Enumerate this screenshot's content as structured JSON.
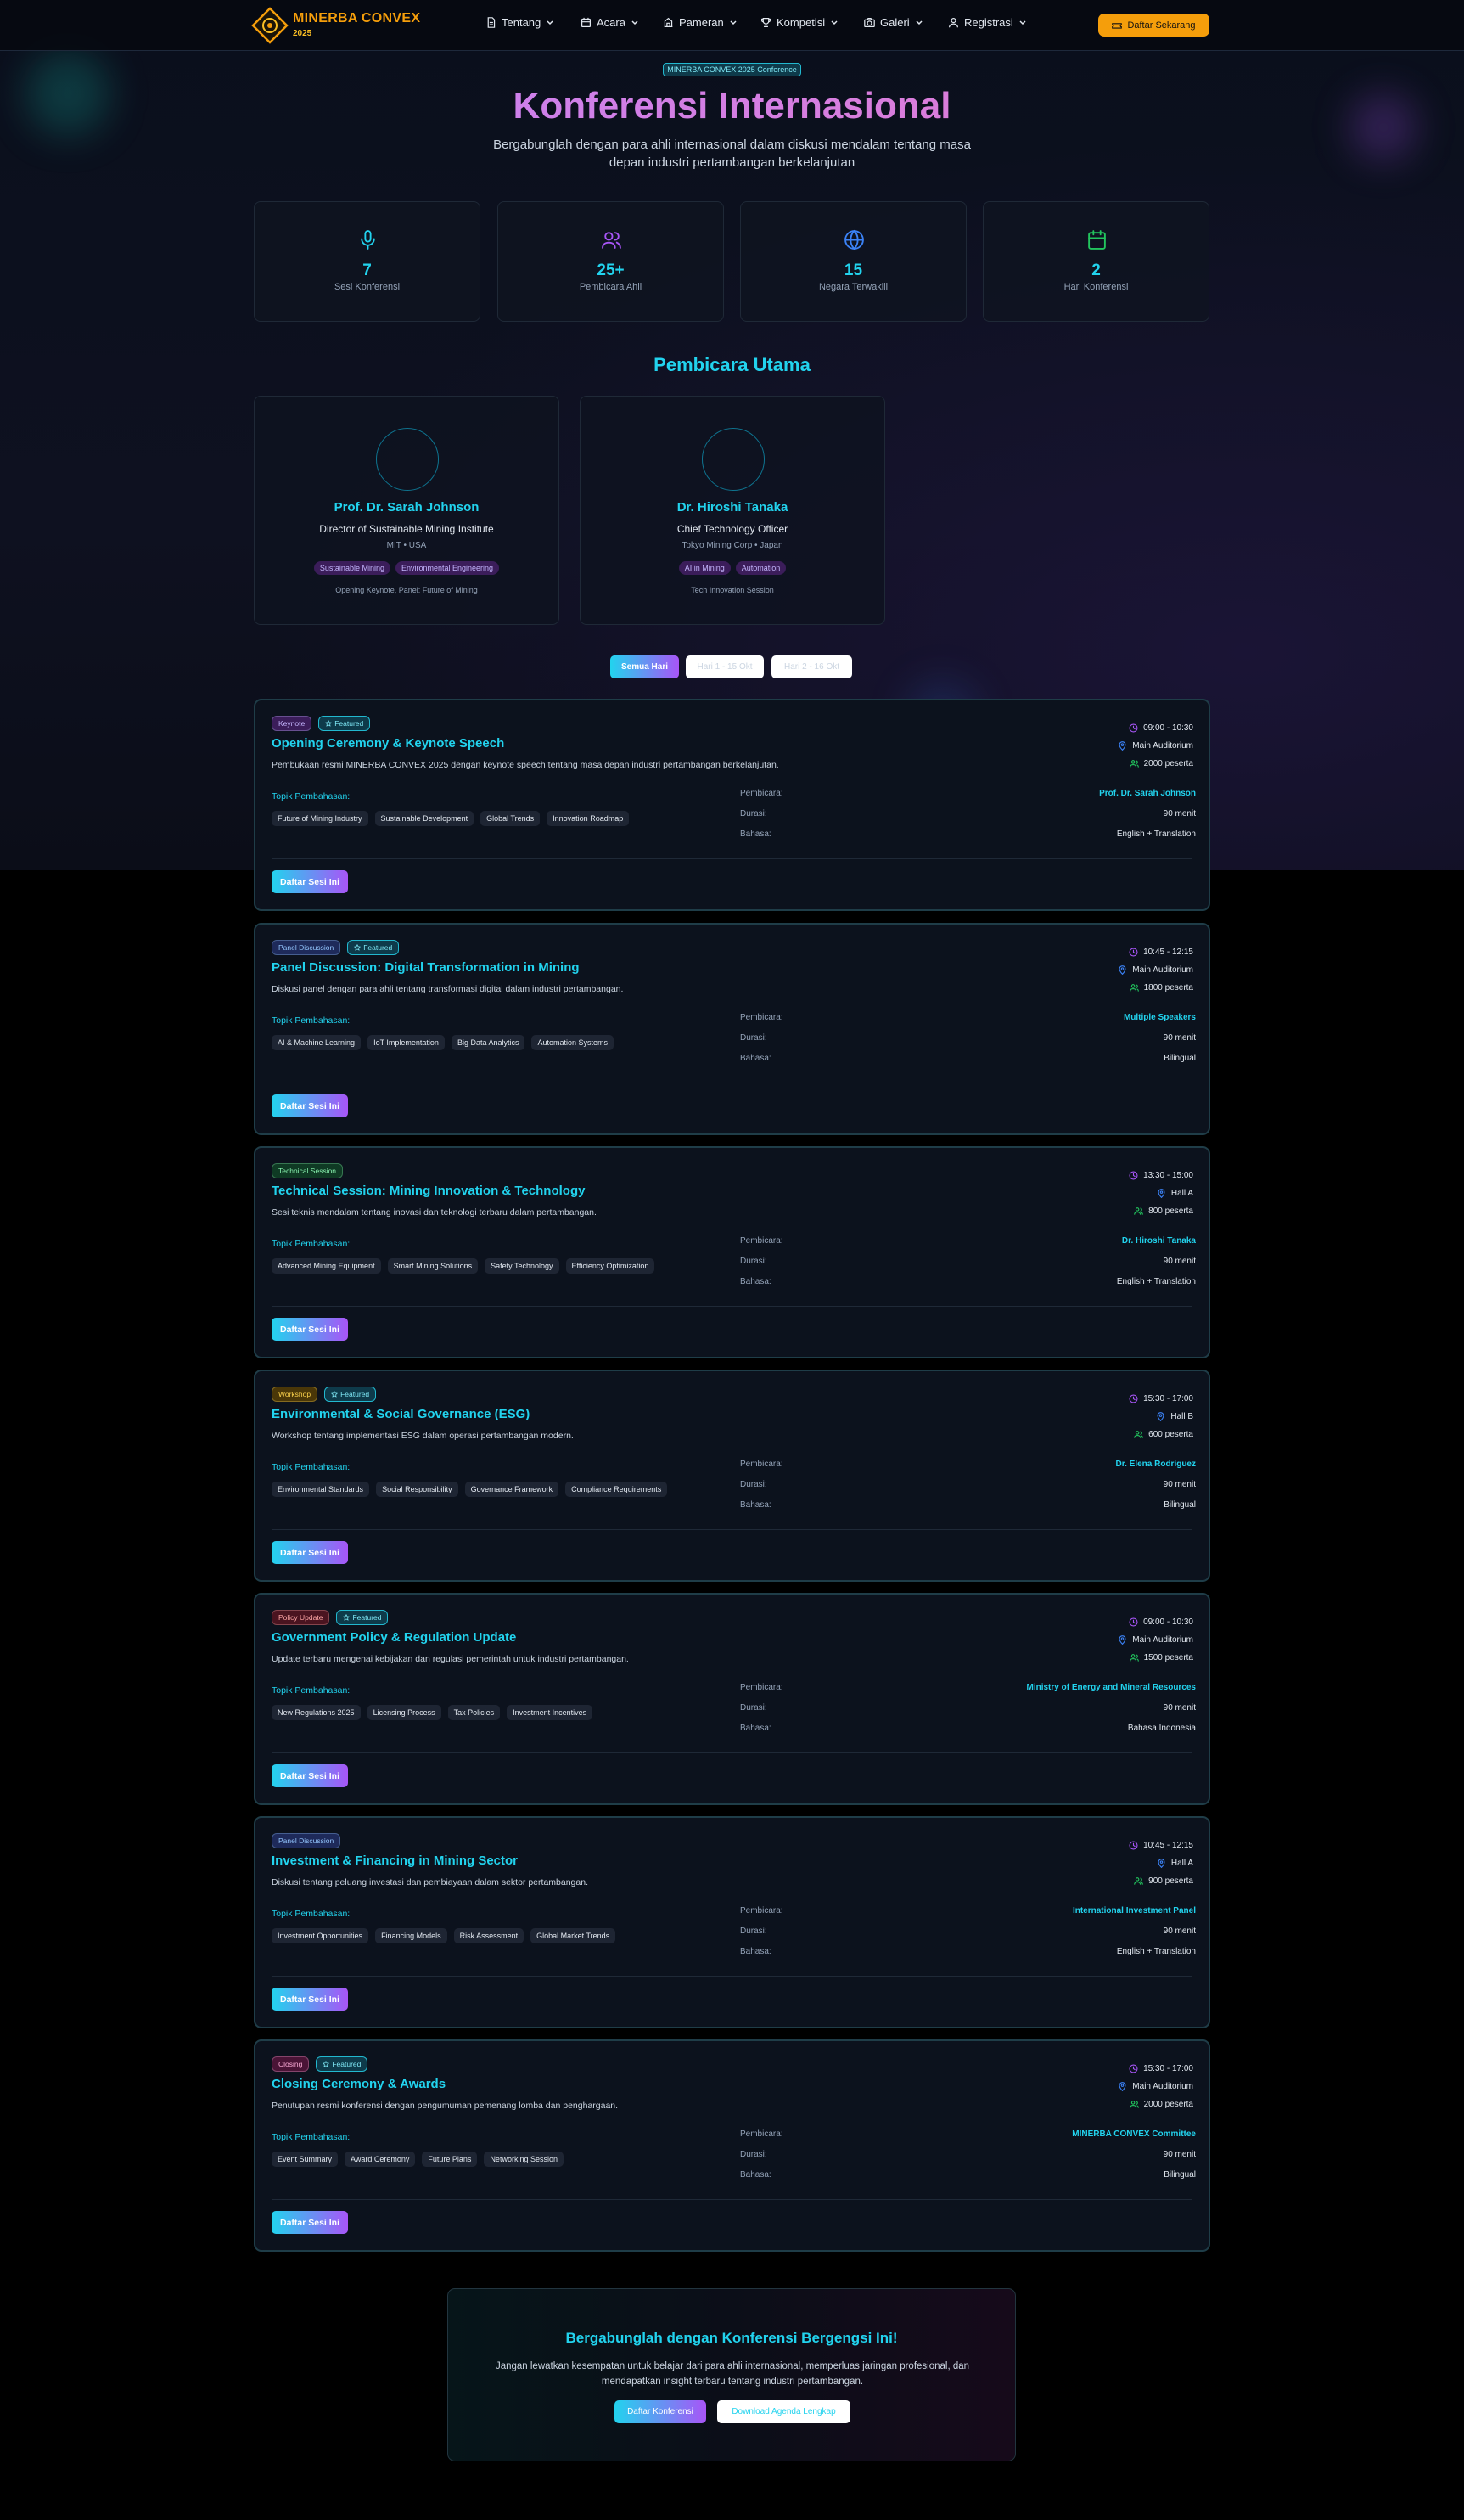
{
  "brand": {
    "name": "MINERBA CONVEX",
    "year": "2025"
  },
  "nav": [
    {
      "label": "Tentang",
      "icon": "document-icon"
    },
    {
      "label": "Acara",
      "icon": "calendar-icon"
    },
    {
      "label": "Pameran",
      "icon": "building-icon"
    },
    {
      "label": "Kompetisi",
      "icon": "trophy-icon"
    },
    {
      "label": "Galeri",
      "icon": "camera-icon"
    },
    {
      "label": "Registrasi",
      "icon": "user-icon"
    }
  ],
  "cta": "Daftar Sekarang",
  "hero": {
    "pill": "MINERBA CONVEX 2025 Conference",
    "title": "Konferensi Internasional",
    "subtitle": "Bergabunglah dengan para ahli internasional dalam diskusi mendalam tentang masa depan industri pertambangan berkelanjutan"
  },
  "stats": [
    {
      "value": "7",
      "label": "Sesi Konferensi",
      "icon": "microphone-icon",
      "color": "#22d3ee"
    },
    {
      "value": "25+",
      "label": "Pembicara Ahli",
      "icon": "users-icon",
      "color": "#a855f7"
    },
    {
      "value": "15",
      "label": "Negara Terwakili",
      "icon": "globe-icon",
      "color": "#3b82f6"
    },
    {
      "value": "2",
      "label": "Hari Konferensi",
      "icon": "calendar-icon",
      "color": "#22c55e"
    }
  ],
  "speakers_title": "Pembicara Utama",
  "speakers": [
    {
      "name": "Prof. Dr. Sarah Johnson",
      "role": "Director of Sustainable Mining Institute",
      "org": "MIT • USA",
      "tags": [
        "Sustainable Mining",
        "Environmental Engineering"
      ],
      "sessions": "Opening Keynote, Panel: Future of Mining"
    },
    {
      "name": "Dr. Hiroshi Tanaka",
      "role": "Chief Technology Officer",
      "org": "Tokyo Mining Corp • Japan",
      "tags": [
        "AI in Mining",
        "Automation"
      ],
      "sessions": "Tech Innovation Session"
    }
  ],
  "filters": [
    "Semua Hari",
    "Hari 1 - 15 Okt",
    "Hari 2 - 16 Okt"
  ],
  "labels": {
    "topics": "Topik Pembahasan:",
    "speaker": "Pembicara:",
    "duration": "Durasi:",
    "language": "Bahasa:",
    "register": "Daftar Sesi Ini",
    "featured": "Featured"
  },
  "sessions": [
    {
      "type": "Keynote",
      "type_bg": "#3b1d5a",
      "type_fg": "#c4b5fd",
      "featured": true,
      "title": "Opening Ceremony & Keynote Speech",
      "desc": "Pembukaan resmi MINERBA CONVEX 2025 dengan keynote speech tentang masa depan industri pertambangan berkelanjutan.",
      "topics": [
        "Future of Mining Industry",
        "Sustainable Development",
        "Global Trends",
        "Innovation Roadmap"
      ],
      "time": "09:00 - 10:30",
      "room": "Main Auditorium",
      "capacity": "2000 peserta",
      "speaker": "Prof. Dr. Sarah Johnson",
      "duration": "90 menit",
      "language": "English + Translation"
    },
    {
      "type": "Panel Discussion",
      "type_bg": "#1e2a5a",
      "type_fg": "#93c5fd",
      "featured": true,
      "title": "Panel Discussion: Digital Transformation in Mining",
      "desc": "Diskusi panel dengan para ahli tentang transformasi digital dalam industri pertambangan.",
      "topics": [
        "AI & Machine Learning",
        "IoT Implementation",
        "Big Data Analytics",
        "Automation Systems"
      ],
      "time": "10:45 - 12:15",
      "room": "Main Auditorium",
      "capacity": "1800 peserta",
      "speaker": "Multiple Speakers",
      "duration": "90 menit",
      "language": "Bilingual"
    },
    {
      "type": "Technical Session",
      "type_bg": "#0f3a24",
      "type_fg": "#86efac",
      "featured": false,
      "title": "Technical Session: Mining Innovation & Technology",
      "desc": "Sesi teknis mendalam tentang inovasi dan teknologi terbaru dalam pertambangan.",
      "topics": [
        "Advanced Mining Equipment",
        "Smart Mining Solutions",
        "Safety Technology",
        "Efficiency Optimization"
      ],
      "time": "13:30 - 15:00",
      "room": "Hall A",
      "capacity": "800 peserta",
      "speaker": "Dr. Hiroshi Tanaka",
      "duration": "90 menit",
      "language": "English + Translation"
    },
    {
      "type": "Workshop",
      "type_bg": "#4a3708",
      "type_fg": "#fcd34d",
      "featured": true,
      "title": "Environmental & Social Governance (ESG)",
      "desc": "Workshop tentang implementasi ESG dalam operasi pertambangan modern.",
      "topics": [
        "Environmental Standards",
        "Social Responsibility",
        "Governance Framework",
        "Compliance Requirements"
      ],
      "time": "15:30 - 17:00",
      "room": "Hall B",
      "capacity": "600 peserta",
      "speaker": "Dr. Elena Rodriguez",
      "duration": "90 menit",
      "language": "Bilingual"
    },
    {
      "type": "Policy Update",
      "type_bg": "#4a1420",
      "type_fg": "#fca5a5",
      "featured": true,
      "title": "Government Policy & Regulation Update",
      "desc": "Update terbaru mengenai kebijakan dan regulasi pemerintah untuk industri pertambangan.",
      "topics": [
        "New Regulations 2025",
        "Licensing Process",
        "Tax Policies",
        "Investment Incentives"
      ],
      "time": "09:00 - 10:30",
      "room": "Main Auditorium",
      "capacity": "1500 peserta",
      "speaker": "Ministry of Energy and Mineral Resources",
      "duration": "90 menit",
      "language": "Bahasa Indonesia"
    },
    {
      "type": "Panel Discussion",
      "type_bg": "#1e2a5a",
      "type_fg": "#93c5fd",
      "featured": false,
      "title": "Investment & Financing in Mining Sector",
      "desc": "Diskusi tentang peluang investasi dan pembiayaan dalam sektor pertambangan.",
      "topics": [
        "Investment Opportunities",
        "Financing Models",
        "Risk Assessment",
        "Global Market Trends"
      ],
      "time": "10:45 - 12:15",
      "room": "Hall A",
      "capacity": "900 peserta",
      "speaker": "International Investment Panel",
      "duration": "90 menit",
      "language": "English + Translation"
    },
    {
      "type": "Closing",
      "type_bg": "#4a1436",
      "type_fg": "#f9a8d4",
      "featured": true,
      "title": "Closing Ceremony & Awards",
      "desc": "Penutupan resmi konferensi dengan pengumuman pemenang lomba dan penghargaan.",
      "topics": [
        "Event Summary",
        "Award Ceremony",
        "Future Plans",
        "Networking Session"
      ],
      "time": "15:30 - 17:00",
      "room": "Main Auditorium",
      "capacity": "2000 peserta",
      "speaker": "MINERBA CONVEX Committee",
      "duration": "90 menit",
      "language": "Bilingual"
    }
  ],
  "bottom": {
    "title": "Bergabunglah dengan Konferensi Bergengsi Ini!",
    "desc": "Jangan lewatkan kesempatan untuk belajar dari para ahli internasional, memperluas jaringan profesional, dan mendapatkan insight terbaru tentang industri pertambangan.",
    "primary": "Daftar Konferensi",
    "secondary": "Download Agenda Lengkap"
  }
}
